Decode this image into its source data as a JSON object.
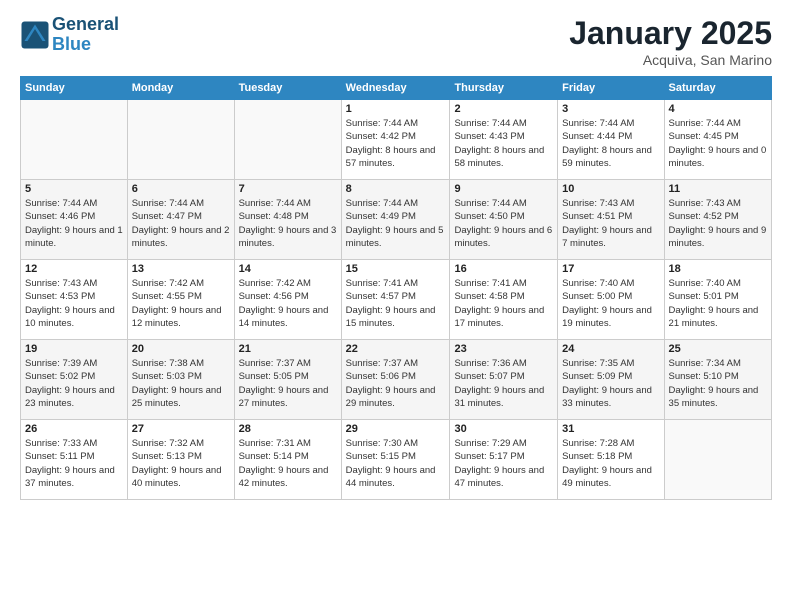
{
  "logo": {
    "line1": "General",
    "line2": "Blue"
  },
  "header": {
    "month": "January 2025",
    "location": "Acquiva, San Marino"
  },
  "weekdays": [
    "Sunday",
    "Monday",
    "Tuesday",
    "Wednesday",
    "Thursday",
    "Friday",
    "Saturday"
  ],
  "weeks": [
    [
      {
        "day": "",
        "info": ""
      },
      {
        "day": "",
        "info": ""
      },
      {
        "day": "",
        "info": ""
      },
      {
        "day": "1",
        "info": "Sunrise: 7:44 AM\nSunset: 4:42 PM\nDaylight: 8 hours and 57 minutes."
      },
      {
        "day": "2",
        "info": "Sunrise: 7:44 AM\nSunset: 4:43 PM\nDaylight: 8 hours and 58 minutes."
      },
      {
        "day": "3",
        "info": "Sunrise: 7:44 AM\nSunset: 4:44 PM\nDaylight: 8 hours and 59 minutes."
      },
      {
        "day": "4",
        "info": "Sunrise: 7:44 AM\nSunset: 4:45 PM\nDaylight: 9 hours and 0 minutes."
      }
    ],
    [
      {
        "day": "5",
        "info": "Sunrise: 7:44 AM\nSunset: 4:46 PM\nDaylight: 9 hours and 1 minute."
      },
      {
        "day": "6",
        "info": "Sunrise: 7:44 AM\nSunset: 4:47 PM\nDaylight: 9 hours and 2 minutes."
      },
      {
        "day": "7",
        "info": "Sunrise: 7:44 AM\nSunset: 4:48 PM\nDaylight: 9 hours and 3 minutes."
      },
      {
        "day": "8",
        "info": "Sunrise: 7:44 AM\nSunset: 4:49 PM\nDaylight: 9 hours and 5 minutes."
      },
      {
        "day": "9",
        "info": "Sunrise: 7:44 AM\nSunset: 4:50 PM\nDaylight: 9 hours and 6 minutes."
      },
      {
        "day": "10",
        "info": "Sunrise: 7:43 AM\nSunset: 4:51 PM\nDaylight: 9 hours and 7 minutes."
      },
      {
        "day": "11",
        "info": "Sunrise: 7:43 AM\nSunset: 4:52 PM\nDaylight: 9 hours and 9 minutes."
      }
    ],
    [
      {
        "day": "12",
        "info": "Sunrise: 7:43 AM\nSunset: 4:53 PM\nDaylight: 9 hours and 10 minutes."
      },
      {
        "day": "13",
        "info": "Sunrise: 7:42 AM\nSunset: 4:55 PM\nDaylight: 9 hours and 12 minutes."
      },
      {
        "day": "14",
        "info": "Sunrise: 7:42 AM\nSunset: 4:56 PM\nDaylight: 9 hours and 14 minutes."
      },
      {
        "day": "15",
        "info": "Sunrise: 7:41 AM\nSunset: 4:57 PM\nDaylight: 9 hours and 15 minutes."
      },
      {
        "day": "16",
        "info": "Sunrise: 7:41 AM\nSunset: 4:58 PM\nDaylight: 9 hours and 17 minutes."
      },
      {
        "day": "17",
        "info": "Sunrise: 7:40 AM\nSunset: 5:00 PM\nDaylight: 9 hours and 19 minutes."
      },
      {
        "day": "18",
        "info": "Sunrise: 7:40 AM\nSunset: 5:01 PM\nDaylight: 9 hours and 21 minutes."
      }
    ],
    [
      {
        "day": "19",
        "info": "Sunrise: 7:39 AM\nSunset: 5:02 PM\nDaylight: 9 hours and 23 minutes."
      },
      {
        "day": "20",
        "info": "Sunrise: 7:38 AM\nSunset: 5:03 PM\nDaylight: 9 hours and 25 minutes."
      },
      {
        "day": "21",
        "info": "Sunrise: 7:37 AM\nSunset: 5:05 PM\nDaylight: 9 hours and 27 minutes."
      },
      {
        "day": "22",
        "info": "Sunrise: 7:37 AM\nSunset: 5:06 PM\nDaylight: 9 hours and 29 minutes."
      },
      {
        "day": "23",
        "info": "Sunrise: 7:36 AM\nSunset: 5:07 PM\nDaylight: 9 hours and 31 minutes."
      },
      {
        "day": "24",
        "info": "Sunrise: 7:35 AM\nSunset: 5:09 PM\nDaylight: 9 hours and 33 minutes."
      },
      {
        "day": "25",
        "info": "Sunrise: 7:34 AM\nSunset: 5:10 PM\nDaylight: 9 hours and 35 minutes."
      }
    ],
    [
      {
        "day": "26",
        "info": "Sunrise: 7:33 AM\nSunset: 5:11 PM\nDaylight: 9 hours and 37 minutes."
      },
      {
        "day": "27",
        "info": "Sunrise: 7:32 AM\nSunset: 5:13 PM\nDaylight: 9 hours and 40 minutes."
      },
      {
        "day": "28",
        "info": "Sunrise: 7:31 AM\nSunset: 5:14 PM\nDaylight: 9 hours and 42 minutes."
      },
      {
        "day": "29",
        "info": "Sunrise: 7:30 AM\nSunset: 5:15 PM\nDaylight: 9 hours and 44 minutes."
      },
      {
        "day": "30",
        "info": "Sunrise: 7:29 AM\nSunset: 5:17 PM\nDaylight: 9 hours and 47 minutes."
      },
      {
        "day": "31",
        "info": "Sunrise: 7:28 AM\nSunset: 5:18 PM\nDaylight: 9 hours and 49 minutes."
      },
      {
        "day": "",
        "info": ""
      }
    ]
  ]
}
